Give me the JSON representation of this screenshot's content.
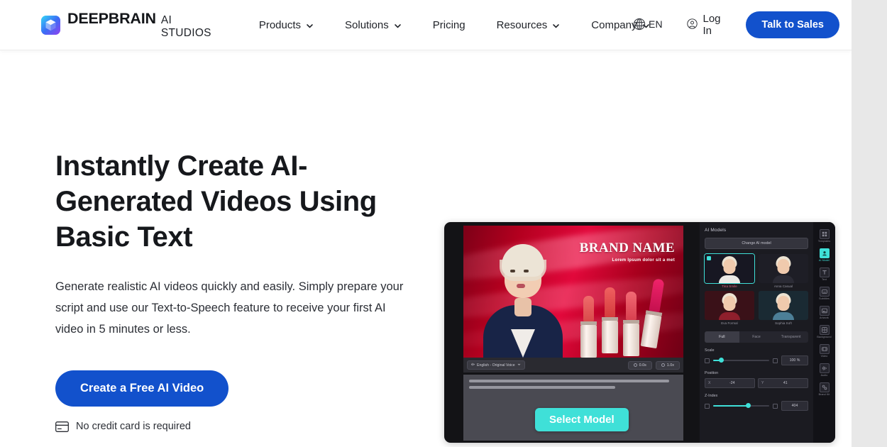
{
  "header": {
    "logo": {
      "icon": "deepbrain-cube-logo-icon",
      "brand": "DEEPBRAIN",
      "product": "AI STUDIOS"
    },
    "nav": [
      {
        "label": "Products",
        "has_dropdown": true
      },
      {
        "label": "Solutions",
        "has_dropdown": true
      },
      {
        "label": "Pricing",
        "has_dropdown": false
      },
      {
        "label": "Resources",
        "has_dropdown": true
      },
      {
        "label": "Company",
        "has_dropdown": true
      }
    ],
    "language": {
      "icon": "globe-icon",
      "code": "EN"
    },
    "login": {
      "icon": "user-circle-icon",
      "label": "Log In"
    },
    "cta": {
      "label": "Talk to Sales",
      "color": "#1251cc"
    }
  },
  "hero": {
    "title": "Instantly Create AI-Generated Videos Using Basic Text",
    "subtitle": "Generate realistic AI videos quickly and easily. Simply prepare your script and use our Text-to-Speech feature to receive your first AI video in 5 minutes or less.",
    "cta_label": "Create a Free AI Video",
    "note_icon": "credit-card-icon",
    "note": "No credit card is required"
  },
  "app_preview": {
    "video": {
      "brand_name": "BRAND NAME",
      "brand_tagline": "Lorem Ipsum dolor sit a met",
      "voice_chip": "English - Original Voice",
      "voice_chip_icon": "voice-wave-icon",
      "duration": "0.0s",
      "speed": "1.0x"
    },
    "select_model_button": {
      "label": "Select Model",
      "color": "#3fe0d8"
    },
    "panel": {
      "title": "AI Models",
      "change_button": "Change AI model",
      "models": [
        {
          "name": "Tina Smile",
          "selected": true,
          "bg": "#171722",
          "shoulder": "#eceae6"
        },
        {
          "name": "Anna Casual",
          "selected": false,
          "bg": "#1e1e26",
          "shoulder": "#2b2b35"
        },
        {
          "name": "Eva Formal",
          "selected": false,
          "bg": "#3a1118",
          "shoulder": "#8f1f2c"
        },
        {
          "name": "Sophia Soft",
          "selected": false,
          "bg": "#1a2a33",
          "shoulder": "#4c7f97"
        }
      ],
      "segments": [
        {
          "label": "Full",
          "active": true
        },
        {
          "label": "Face",
          "active": false
        },
        {
          "label": "Transparent",
          "active": false
        }
      ],
      "controls": [
        {
          "label": "Scale",
          "type": "slider",
          "value": "100 %",
          "fill_pct": 14
        },
        {
          "label": "Position",
          "type": "xy",
          "x_axis": "X",
          "x_value": "-24",
          "y_axis": "Y",
          "y_value": "41"
        },
        {
          "label": "Z-Index",
          "type": "slider",
          "value": "404",
          "fill_pct": 63
        }
      ]
    },
    "rail": [
      {
        "label": "Templates",
        "icon": "templates-icon",
        "active": false
      },
      {
        "label": "AI Model",
        "icon": "ai-model-icon",
        "active": true
      },
      {
        "label": "Text",
        "icon": "text-icon",
        "active": false
      },
      {
        "label": "Subtitles",
        "icon": "subtitles-icon",
        "active": false
      },
      {
        "label": "Artwork",
        "icon": "artwork-icon",
        "active": false
      },
      {
        "label": "Background",
        "icon": "background-icon",
        "active": false
      },
      {
        "label": "Video",
        "icon": "video-icon",
        "active": false
      },
      {
        "label": "Audio",
        "icon": "audio-icon",
        "active": false
      },
      {
        "label": "Brand Kit",
        "icon": "brandkit-icon",
        "active": false
      }
    ]
  }
}
